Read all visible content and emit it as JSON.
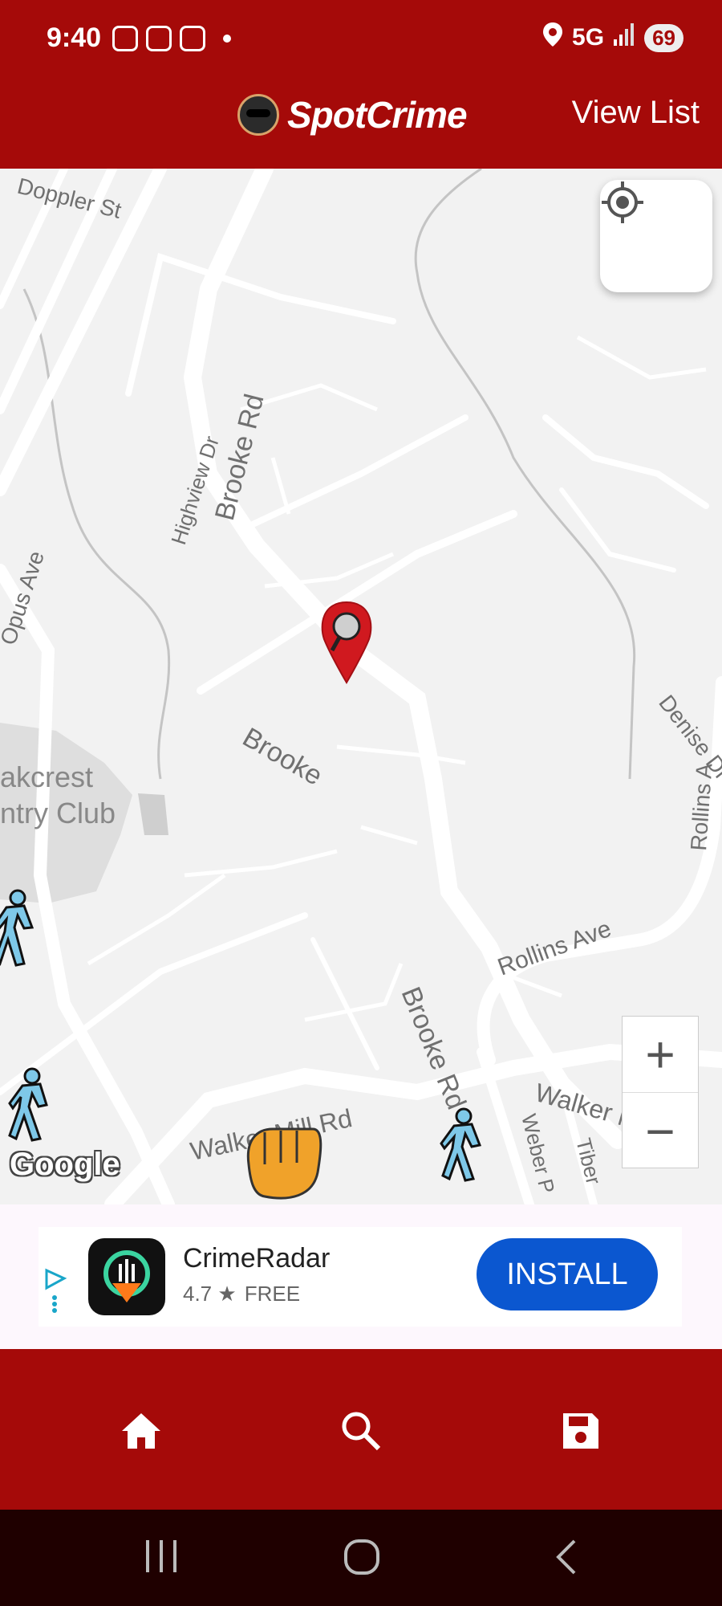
{
  "status_bar": {
    "time": "9:40",
    "network": "5G",
    "battery": "69"
  },
  "app_bar": {
    "logo_text": "SpotCrime",
    "view_list_label": "View List"
  },
  "map": {
    "labels": {
      "doppler_st": "Doppler St",
      "highview_dr": "Highview Dr",
      "brooke_rd_top": "Brooke Rd",
      "opus_ave": "Opus Ave",
      "brooke_mid": "Brooke",
      "brooke_rd_lower": "Brooke Rd",
      "denise_dr": "Denise Dr",
      "rollins_ave_right": "Rollins A",
      "oakcrest": "akcrest",
      "country_club": "ntry Club",
      "rollins_ave": "Rollins Ave",
      "walker_mill_rd_left": "Walker Mill Rd",
      "walker_mill_rd_right": "Walker Mill Rd",
      "weber": "Weber P",
      "tiber": "Tiber"
    },
    "google_logo": "Google",
    "zoom_in_label": "+",
    "zoom_out_label": "−"
  },
  "ad": {
    "app_name": "CrimeRadar",
    "rating": "4.7 ★",
    "price": "FREE",
    "install_label": "INSTALL"
  },
  "icons": {
    "locate": "crosshair-icon",
    "home": "home-icon",
    "search": "search-icon",
    "save": "save-icon"
  },
  "colors": {
    "brand_red": "#a50a09",
    "install_blue": "#0b57d0",
    "crime_marker_blue": "#7ec8e8"
  }
}
